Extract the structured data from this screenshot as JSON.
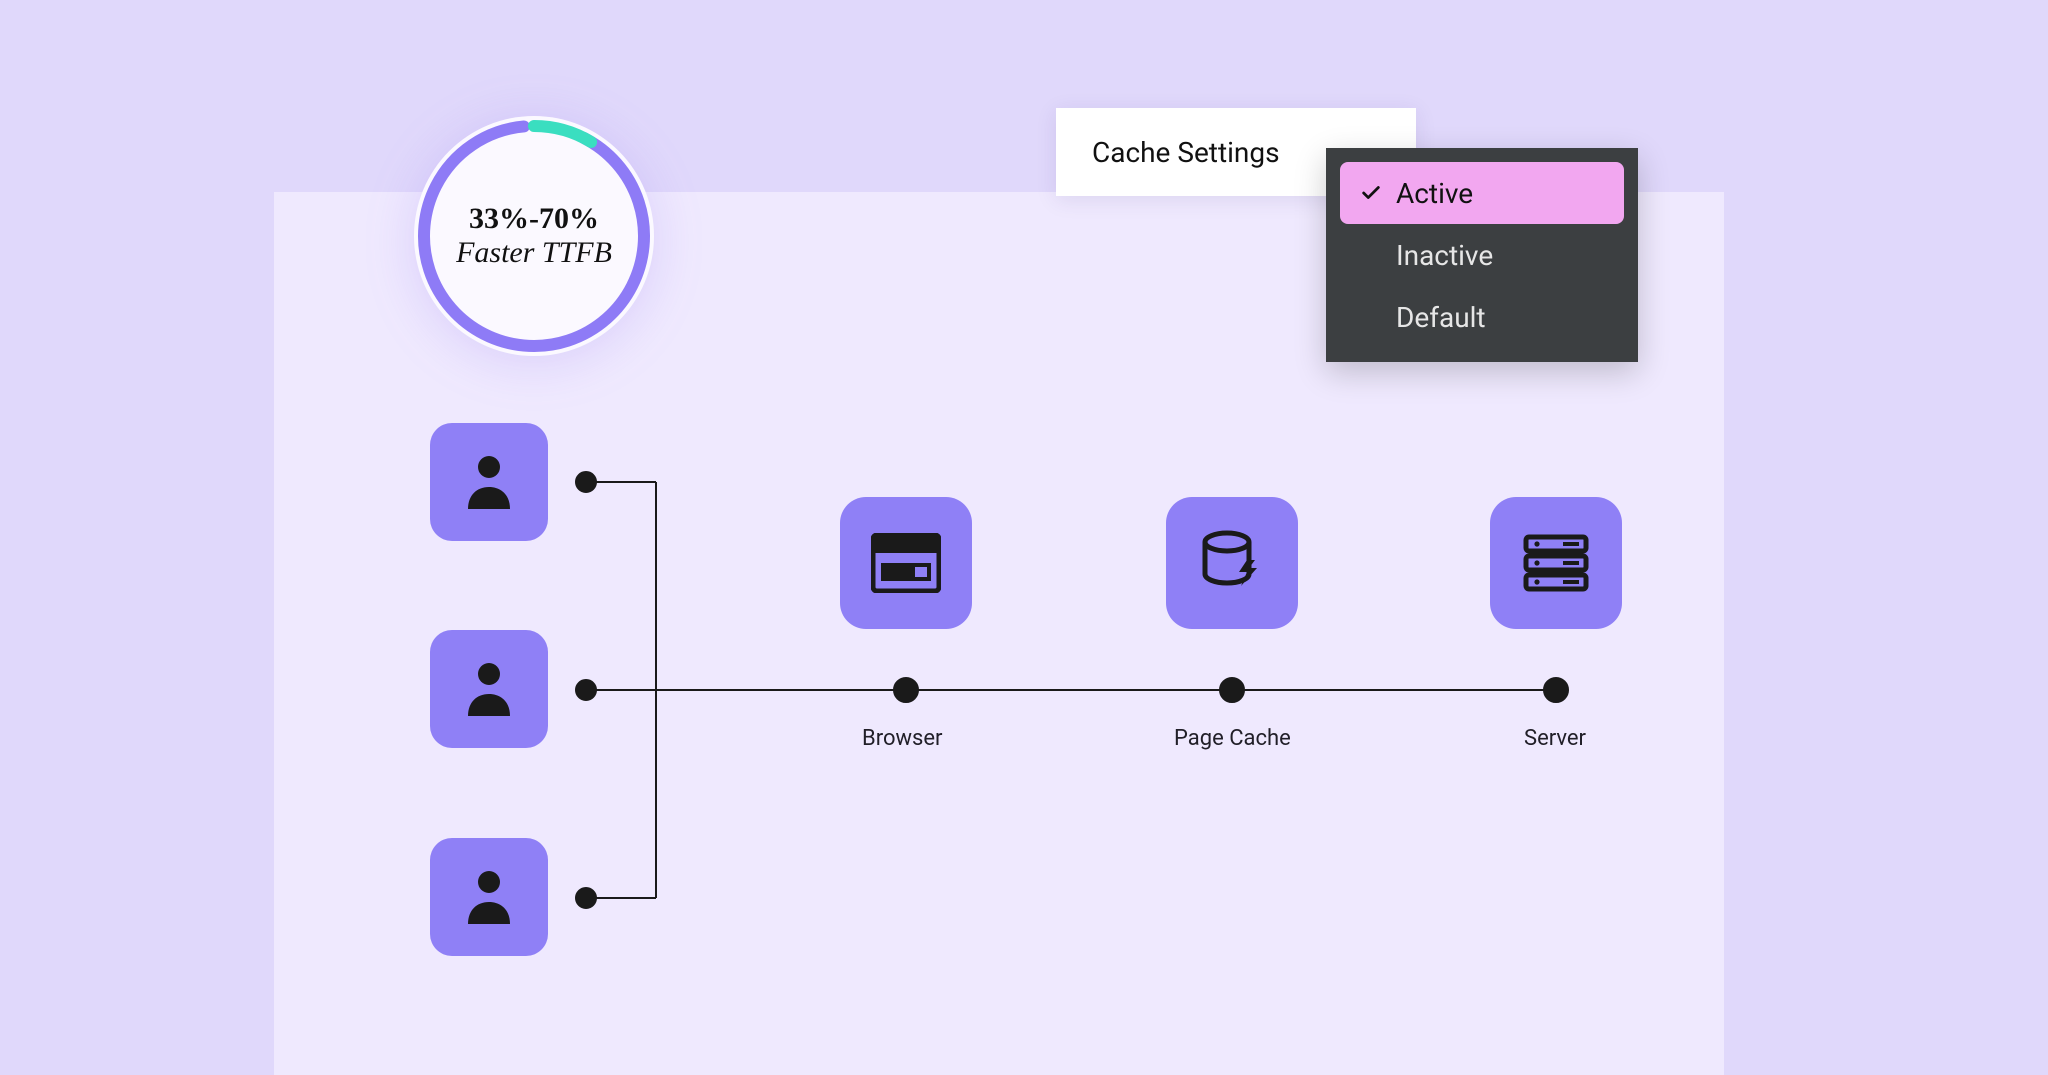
{
  "gauge": {
    "line1": "33%-70%",
    "line2": "Faster TTFB"
  },
  "settings": {
    "title": "Cache Settings",
    "options": {
      "active": "Active",
      "inactive": "Inactive",
      "default": "Default"
    }
  },
  "flow": {
    "browser": "Browser",
    "page_cache": "Page Cache",
    "server": "Server"
  }
}
